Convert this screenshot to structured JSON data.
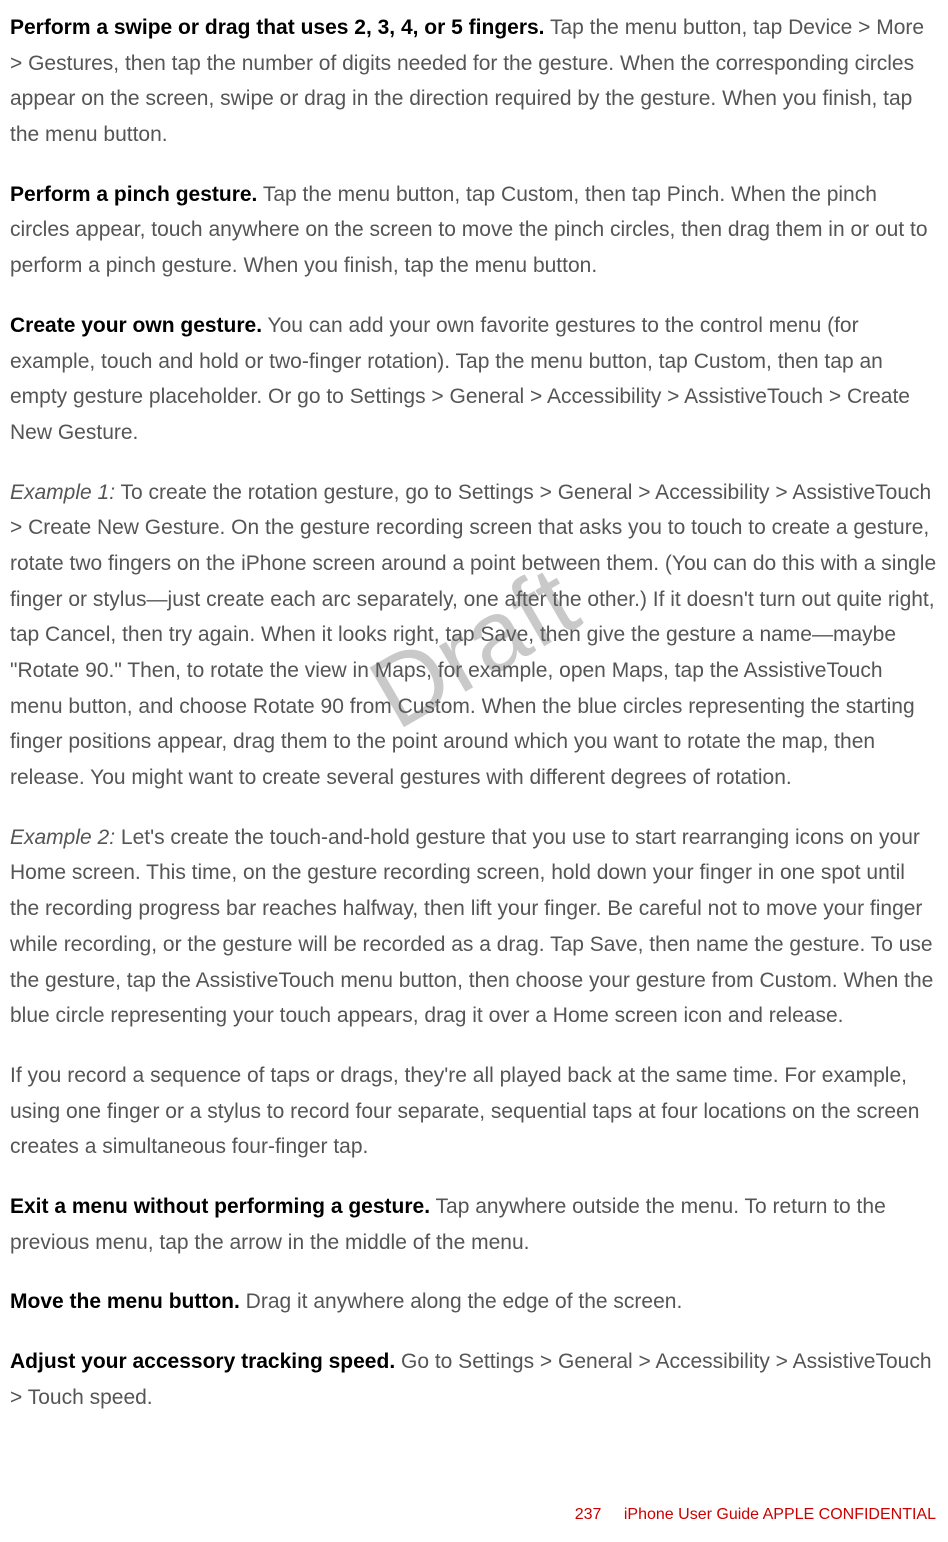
{
  "paragraphs": {
    "p1": {
      "lead": "Perform a swipe or drag that uses 2, 3, 4, or 5 fingers.",
      "body": " Tap the menu button, tap Device > More > Gestures, then tap the number of digits needed for the gesture. When the corresponding circles appear on the screen, swipe or drag in the direction required by the gesture. When you finish, tap the menu button."
    },
    "p2": {
      "lead": "Perform a pinch gesture.",
      "body": " Tap the menu button, tap Custom, then tap Pinch. When the pinch circles appear, touch anywhere on the screen to move the pinch circles, then drag them in or out to perform a pinch gesture. When you finish, tap the menu button."
    },
    "p3": {
      "lead": "Create your own gesture.",
      "body": " You can add your own favorite gestures to the control menu (for example, touch and hold or two-finger rotation). Tap the menu button, tap Custom, then tap an empty gesture placeholder. Or go to Settings > General > Accessibility > AssistiveTouch > Create New Gesture."
    },
    "p4": {
      "lead": "Example 1:",
      "body": " To create the rotation gesture, go to Settings > General > Accessibility > AssistiveTouch > Create New Gesture. On the gesture recording screen that asks you to touch to create a gesture, rotate two fingers on the iPhone screen around a point between them. (You can do this with a single finger or stylus—just create each arc separately, one after the other.) If it doesn't turn out quite right, tap Cancel, then try again. When it looks right, tap Save, then give the gesture a name—maybe \"Rotate 90.\" Then, to rotate the view in Maps, for example, open Maps, tap the AssistiveTouch menu button, and choose Rotate 90 from Custom. When the blue circles representing the starting finger positions appear, drag them to the point around which you want to rotate the map, then release. You might want to create several gestures with different degrees of rotation."
    },
    "p5": {
      "lead": "Example 2:",
      "body": " Let's create the touch-and-hold gesture that you use to start rearranging icons on your Home screen. This time, on the gesture recording screen, hold down your finger in one spot until the recording progress bar reaches halfway, then lift your finger. Be careful not to move your finger while recording, or the gesture will be recorded as a drag. Tap Save, then name the gesture. To use the gesture, tap the AssistiveTouch menu button, then choose your gesture from Custom. When the blue circle representing your touch appears, drag it over a Home screen icon and release."
    },
    "p6": {
      "body": "If you record a sequence of taps or drags, they're all played back at the same time. For example, using one finger or a stylus to record four separate, sequential taps at four locations on the screen creates a simultaneous four-finger tap."
    },
    "p7": {
      "lead": "Exit a menu without performing a gesture.",
      "body": " Tap anywhere outside the menu. To return to the previous menu, tap the arrow in the middle of the menu."
    },
    "p8": {
      "lead": "Move the menu button.",
      "body": " Drag it anywhere along the edge of the screen."
    },
    "p9": {
      "lead": "Adjust your accessory tracking speed.",
      "body": " Go to Settings > General > Accessibility > AssistiveTouch > Touch speed."
    }
  },
  "watermark": "Draft",
  "footer": {
    "page_number": "237",
    "doc_title": "iPhone User Guide",
    "confidential": "  APPLE CONFIDENTIAL"
  }
}
